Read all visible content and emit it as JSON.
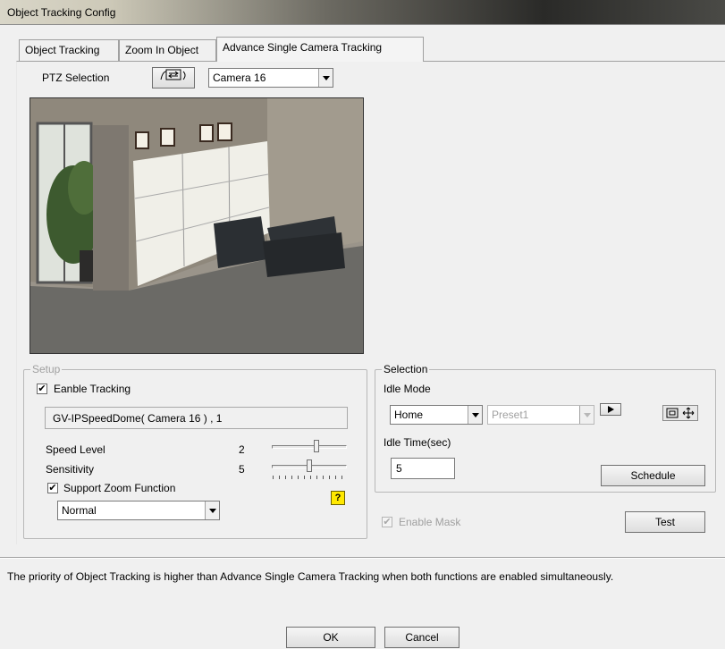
{
  "window": {
    "title": "Object Tracking Config"
  },
  "tabs": [
    {
      "label": "Object Tracking"
    },
    {
      "label": "Zoom In Object"
    },
    {
      "label": "Advance Single Camera Tracking"
    }
  ],
  "ptz": {
    "label": "PTZ Selection",
    "camera_selected": "Camera 16",
    "ptz_button_icon": "camera-switch-icon"
  },
  "setup": {
    "group_title": "Setup",
    "enable_tracking": {
      "label": "Eanble Tracking",
      "checked": true
    },
    "device_name": "GV-IPSpeedDome( Camera 16 ) , 1",
    "speed_level": {
      "label": "Speed Level",
      "value": "2",
      "fraction": 0.6
    },
    "sensitivity": {
      "label": "Sensitivity",
      "value": "5",
      "fraction": 0.5
    },
    "support_zoom": {
      "label": "Support Zoom Function",
      "checked": true
    },
    "zoom_mode": "Normal",
    "help_icon": "help-icon"
  },
  "selection": {
    "group_title": "Selection",
    "idle_mode_label": "Idle Mode",
    "idle_mode_value": "Home",
    "preset_value": "Preset1",
    "idle_time_label": "Idle Time(sec)",
    "idle_time_value": "5",
    "schedule_label": "Schedule"
  },
  "enable_mask": {
    "label": "Enable Mask",
    "checked": true,
    "disabled": true
  },
  "test_label": "Test",
  "note": "The priority of Object Tracking is higher than Advance Single Camera Tracking when both functions are enabled simultaneously.",
  "footer": {
    "ok_label": "OK",
    "cancel_label": "Cancel"
  }
}
